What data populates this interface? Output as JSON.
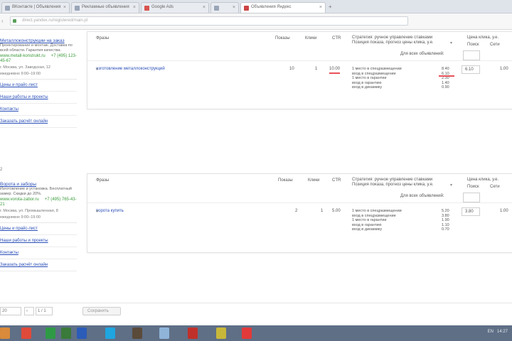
{
  "tabs": [
    {
      "title": "ВКонтакте | Объявления"
    },
    {
      "title": "Рекламные объявления"
    },
    {
      "title": "Google Ads"
    },
    {
      "title": ""
    },
    {
      "title": "Объявления Яндекс"
    }
  ],
  "address": {
    "url": "direct.yandex.ru/registered/main.pl"
  },
  "ads": [
    {
      "num": "",
      "title": "Металлоконструкции на заказ",
      "desc": "Проектирование и монтаж. Доставка по всей области. Гарантия качества.",
      "url": "www.metall-konstrukt.ru",
      "phone": "+7 (495) 123-45-67",
      "addr": "г. Москва, ул. Заводская, 12",
      "addr2": "ежедневно 9:00–19:00",
      "sitelinks": [
        "Цены и прайс-лист",
        "Наши работы и проекты",
        "Контакты",
        "Заказать расчёт онлайн"
      ]
    },
    {
      "num": "2",
      "title": "Ворота и заборы",
      "desc": "Изготовление и установка. Бесплатный замер. Скидки до 20%.",
      "url": "www.vorota-zabor.ru",
      "phone": "+7 (495) 765-43-21",
      "addr": "г. Москва, ул. Промышленная, 8",
      "addr2": "ежедневно 9:00–19:00",
      "sitelinks": [
        "Цены и прайс-лист",
        "Наши работы и проекты",
        "Контакты",
        "Заказать расчёт онлайн"
      ]
    }
  ],
  "table_header": {
    "keyword": "Фразы",
    "shows": "Показы",
    "clicks": "Клики",
    "ctr": "CTR",
    "pos_line1": "Стратегия: ручное управление ставками",
    "pos_line2": "Позиция показа, прогноз цены клика, у.е.",
    "pos_arrow": "▾",
    "bid_title": "Цена клика, у.е.",
    "bid_a": "Поиск",
    "bid_b": "Сети",
    "all_label": "Для всех объявлений:"
  },
  "rows": [
    {
      "keyword": "изготовление металлоконструкций",
      "shows": "10",
      "clicks": "1",
      "ctr": "10.00",
      "ctr_red": true,
      "pos_lines": [
        "1 место в спецразмещении",
        "вход в спецразмещение",
        "1 место в гарантии",
        "вход в гарантию",
        "вход в динамику"
      ],
      "pos_vals": [
        "8.40",
        "6.10",
        "2.30",
        "1.40",
        "0.90"
      ],
      "red_dash": true,
      "bid": "6.10",
      "bid2": "1.00"
    },
    {
      "keyword": "ворота купить",
      "shows": "2",
      "clicks": "1",
      "ctr": "5.00",
      "ctr_red": false,
      "pos_lines": [
        "1 место в спецразмещении",
        "вход в спецразмещение",
        "1 место в гарантии",
        "вход в гарантию",
        "вход в динамику"
      ],
      "pos_vals": [
        "5.20",
        "3.80",
        "1.90",
        "1.10",
        "0.70"
      ],
      "red_dash": false,
      "bid": "3.80",
      "bid2": "1.00"
    }
  ],
  "pager": {
    "per_page": "20",
    "page": "1 / 1",
    "save": "Сохранить"
  },
  "tray": {
    "lang": "EN",
    "time": "14:27"
  },
  "colors": {
    "link": "#2a4fb8",
    "url": "#3a9a3a",
    "alert": "#e8525a",
    "taskbar": "#5f6f86"
  }
}
